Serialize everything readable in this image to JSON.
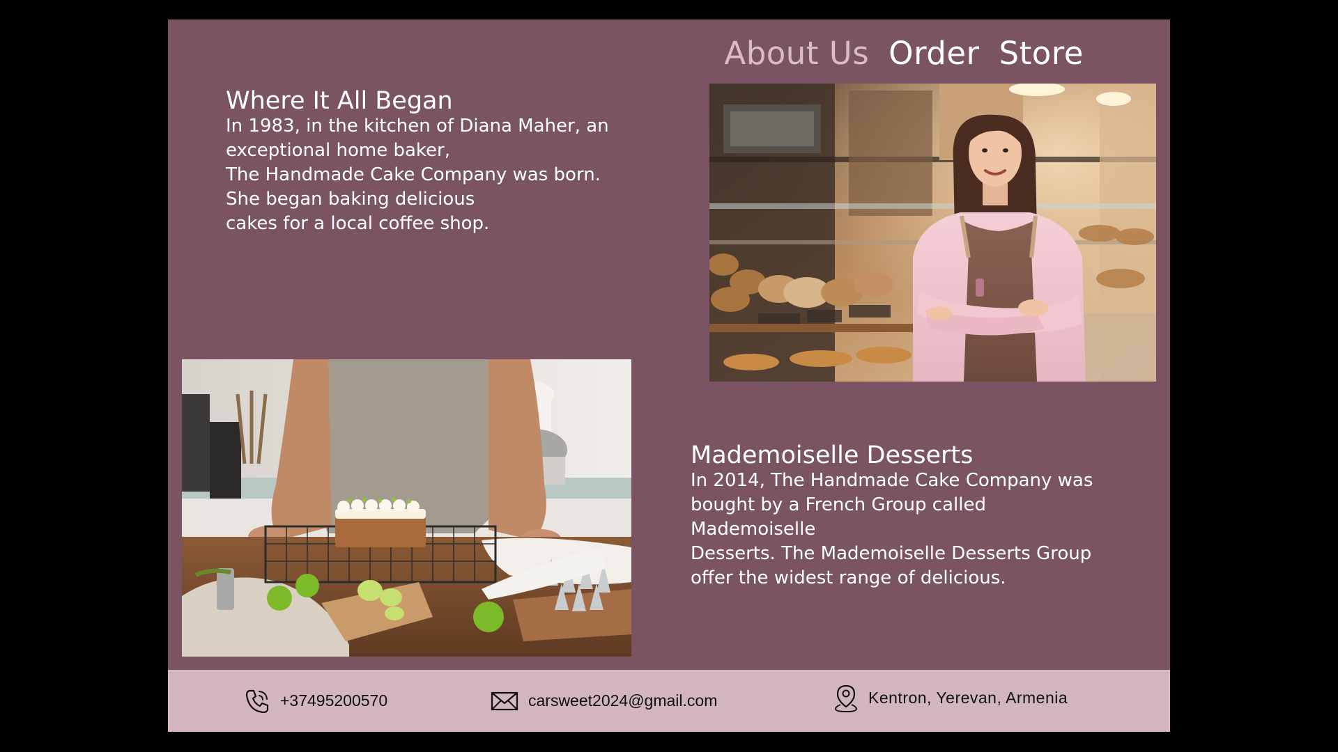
{
  "nav": {
    "items": [
      {
        "label": "About Us",
        "active": true
      },
      {
        "label": "Order",
        "active": false
      },
      {
        "label": "Store",
        "active": false
      }
    ]
  },
  "history": {
    "title": "Where It All Began",
    "body": "In 1983, in the kitchen of Diana Maher, an\n exceptional home baker,\nThe Handmade Cake Company was born.\n She began baking delicious\n cakes for a local coffee shop."
  },
  "desserts": {
    "title": "Mademoiselle Desserts",
    "body": "In 2014, The Handmade Cake Company was\nbought by a French Group called\nMademoiselle\nDesserts. The Mademoiselle Desserts Group\noffer the widest range of delicious."
  },
  "images": {
    "baker": {
      "icon": "bakery-owner-photo"
    },
    "cake": {
      "icon": "lime-cake-photo"
    }
  },
  "footer": {
    "phone": {
      "icon": "phone-icon",
      "text": "+37495200570"
    },
    "email": {
      "icon": "mail-icon",
      "text": "carsweet2024@gmail.com"
    },
    "location": {
      "icon": "location-pin-icon",
      "text": "Kentron, Yerevan, Armenia"
    }
  },
  "colors": {
    "background": "#000000",
    "page": "#7a5462",
    "footer": "#d2b5bd",
    "nav_active": "#d8bcc6",
    "text": "#ffffff"
  }
}
